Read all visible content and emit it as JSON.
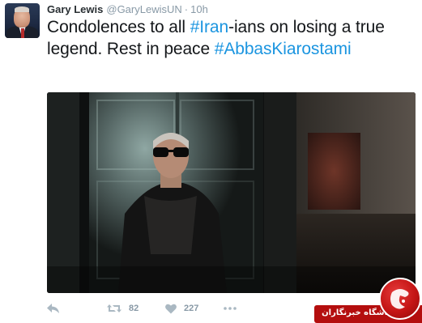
{
  "tweet": {
    "author_name": "Gary Lewis",
    "author_handle": "@GaryLewisUN",
    "separator": "·",
    "time": "10h",
    "text_part1": "Condolences to all ",
    "hashtag1": "#Iran",
    "text_part2": "-ians on losing a true legend. Rest in peace ",
    "hashtag2": "#AbbasKiarostami",
    "retweet_count": "82",
    "like_count": "227"
  },
  "icons": {
    "reply": "reply-icon",
    "retweet": "retweet-icon",
    "like": "heart-icon",
    "more": "more-icon"
  },
  "colors": {
    "hashtag": "#1b95e0",
    "name": "#292f33",
    "meta": "#8899a6",
    "action_icon": "#aab8c2",
    "watermark": "#b40e0e"
  },
  "watermark": {
    "text": "باشگاه خبرنگاران",
    "logo_letter": "ج"
  }
}
